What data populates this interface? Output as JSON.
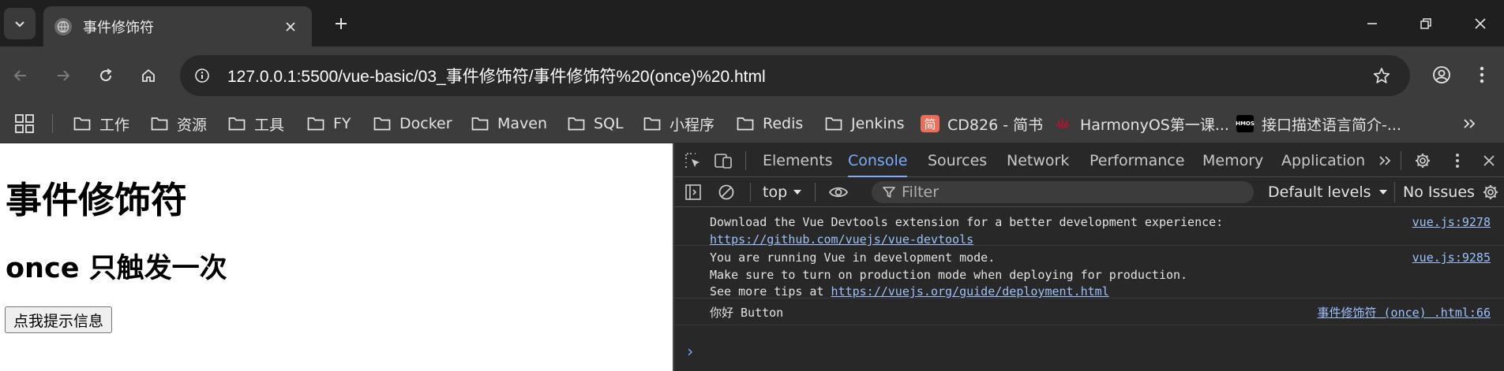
{
  "colors": {
    "accent": "#7cacf8",
    "link": "#9ec1fa",
    "tab_bg": "#3c3c3c",
    "chrome_bg": "#1f1f1f"
  },
  "tab": {
    "title": "事件修饰符",
    "favicon": "globe-icon"
  },
  "toolbar": {
    "url": "127.0.0.1:5500/vue-basic/03_事件修饰符/事件修饰符%20(once)%20.html"
  },
  "bookmarks": [
    {
      "label": "工作",
      "icon": "folder-icon"
    },
    {
      "label": "资源",
      "icon": "folder-icon"
    },
    {
      "label": "工具",
      "icon": "folder-icon"
    },
    {
      "label": "FY",
      "icon": "folder-icon"
    },
    {
      "label": "Docker",
      "icon": "folder-icon"
    },
    {
      "label": "Maven",
      "icon": "folder-icon"
    },
    {
      "label": "SQL",
      "icon": "folder-icon"
    },
    {
      "label": "小程序",
      "icon": "folder-icon"
    },
    {
      "label": "Redis",
      "icon": "folder-icon"
    },
    {
      "label": "Jenkins",
      "icon": "folder-icon"
    },
    {
      "label": "CD826 - 简书",
      "icon": "jianshu-icon",
      "icon_text": "简"
    },
    {
      "label": "HarmonyOS第一课...",
      "icon": "huawei-icon"
    },
    {
      "label": "接口描述语言简介-...",
      "icon": "hmos-icon",
      "icon_text": "HMOS"
    }
  ],
  "page": {
    "heading": "事件修饰符",
    "subheading": "once 只触发一次",
    "button_label": "点我提示信息"
  },
  "devtools": {
    "tabs": [
      "Elements",
      "Console",
      "Sources",
      "Network",
      "Performance",
      "Memory",
      "Application"
    ],
    "active_tab": "Console",
    "context": "top",
    "filter_placeholder": "Filter",
    "levels": "Default levels",
    "issues": "No Issues",
    "messages": [
      {
        "lines": [
          "Download the Vue Devtools extension for a better development experience:"
        ],
        "link": "https://github.com/vuejs/vue-devtools",
        "source": "vue.js:9278"
      },
      {
        "lines": [
          "You are running Vue in development mode.",
          "Make sure to turn on production mode when deploying for production.",
          "See more tips at "
        ],
        "link": "https://vuejs.org/guide/deployment.html",
        "source": "vue.js:9285"
      },
      {
        "lines": [
          "你好 Button"
        ],
        "source": "事件修饰符 (once) .html:66"
      }
    ],
    "prompt": "›"
  }
}
